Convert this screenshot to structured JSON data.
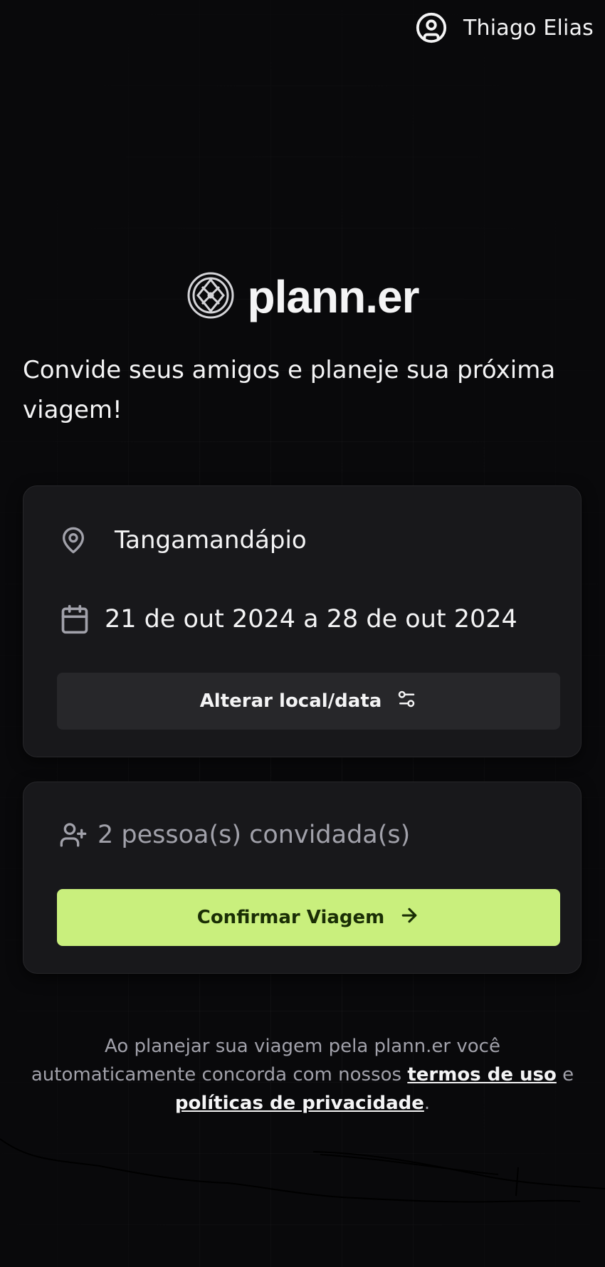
{
  "header": {
    "user_name": "Thiago Elias",
    "user_icon": "user-circle-icon"
  },
  "brand": {
    "logo_icon": "globe-compass-icon",
    "name": "plann.er"
  },
  "tagline": "Convide seus amigos e planeje sua próxima viagem!",
  "trip": {
    "destination": "Tangamandápio",
    "destination_icon": "map-pin-icon",
    "dates": "21 de out 2024 a 28 de out 2024",
    "dates_icon": "calendar-icon",
    "change_button_label": "Alterar local/data",
    "change_button_icon": "settings-sliders-icon"
  },
  "guests": {
    "summary": "2 pessoa(s) convidada(s)",
    "icon": "user-plus-icon",
    "confirm_button_label": "Confirmar Viagem",
    "confirm_button_icon": "arrow-right-icon"
  },
  "footer": {
    "text_before": "Ao planejar sua viagem pela plann.er você automaticamente concorda com nossos ",
    "terms_link": "termos de uso",
    "connector": " e ",
    "privacy_link": "políticas de privacidade",
    "text_after": "."
  },
  "colors": {
    "background": "#09090b",
    "card": "#18181b",
    "secondary_button": "#27272a",
    "accent": "#c9ef7d"
  }
}
